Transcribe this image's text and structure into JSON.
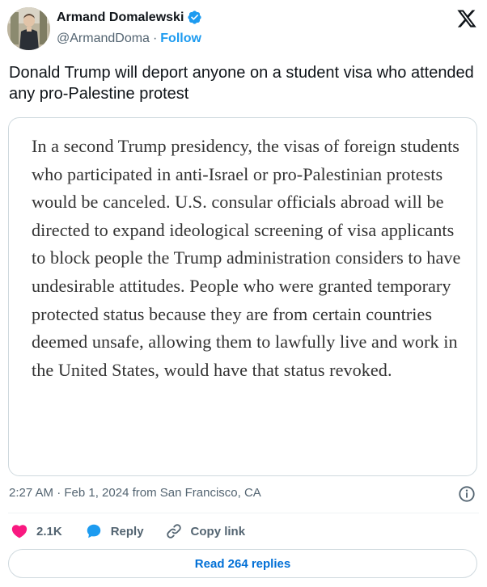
{
  "author": {
    "display_name": "Armand Domalewski",
    "handle": "@ArmandDoma",
    "follow_label": "Follow",
    "separator": "·"
  },
  "tweet": {
    "text": "Donald Trump will deport anyone on a student visa who attended any pro-Palestine protest",
    "media_text": "In a second Trump presidency, the visas of foreign students who participated in anti-Israel or pro-Palestinian protests would be canceled. U.S. consular officials abroad will be directed to expand ideological screening of visa applicants to block people the Trump administration considers to have undesirable attitudes. People who were granted temporary protected status because they are from certain countries deemed unsafe, allowing them to lawfully live and work in the United States, would have that status revoked.",
    "timestamp": "2:27 AM · Feb 1, 2024 from San Francisco, CA"
  },
  "actions": {
    "likes": "2.1K",
    "reply_label": "Reply",
    "copy_link_label": "Copy link"
  },
  "read_replies_label": "Read 264 replies",
  "icons": {
    "verified": "verified-badge-icon",
    "brand": "x-logo-icon",
    "info": "info-icon",
    "like": "heart-icon",
    "reply": "reply-bubble-icon",
    "link": "link-icon"
  },
  "colors": {
    "accent": "#1d9bf0",
    "like": "#f91880",
    "muted": "#536471",
    "link": "#006fd6"
  }
}
